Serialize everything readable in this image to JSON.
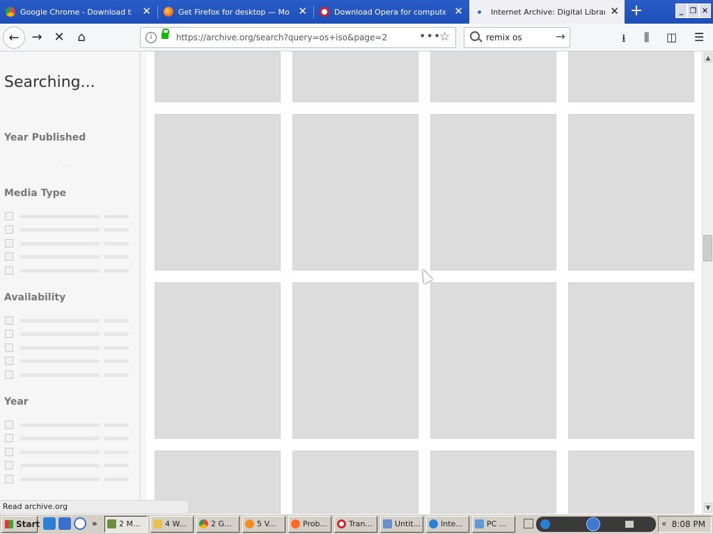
{
  "browser": {
    "tabs": [
      {
        "title": "Google Chrome - Download the Fa",
        "icon": "chrome-icon",
        "color": "#e8453c",
        "active": false
      },
      {
        "title": "Get Firefox for desktop — Mozilla",
        "icon": "firefox-icon",
        "color": "#ff8a1f",
        "active": false
      },
      {
        "title": "Download Opera for computers - (",
        "icon": "opera-icon",
        "color": "#d4232b",
        "active": false
      },
      {
        "title": "Internet Archive: Digital Library of",
        "icon": "archive-icon",
        "color": "#3b6bcf",
        "active": true
      }
    ],
    "window_buttons": {
      "minimize": "_",
      "restore": "❐",
      "close": "✕"
    },
    "new_tab": "+",
    "url": "https://archive.org/search?query=os+iso&page=2",
    "search_value": "remix os",
    "status_text": "Read archive.org"
  },
  "sidebar": {
    "heading": "Searching...",
    "facets": [
      {
        "title": "Year Published",
        "placeholder_count": 0
      },
      {
        "title": "Media Type",
        "placeholder_count": 5
      },
      {
        "title": "Availability",
        "placeholder_count": 5
      },
      {
        "title": "Year",
        "placeholder_count": 5
      }
    ]
  },
  "results": {
    "columns": 4,
    "visible_rows": 4,
    "tile_color": "#dcdcdc"
  },
  "taskbar": {
    "start_label": "Start",
    "buttons": [
      {
        "label": "2 M...",
        "icon": "mixed-windows-icon",
        "color": "#6b8f3a",
        "pressed": true
      },
      {
        "label": "4 W...",
        "icon": "folder-icon",
        "color": "#e8c24a",
        "pressed": false
      },
      {
        "label": "2 G...",
        "icon": "chrome-icon",
        "color": "#e8453c",
        "pressed": false
      },
      {
        "label": "5 V...",
        "icon": "firefox-icon",
        "color": "#ff8a1f",
        "pressed": false
      },
      {
        "label": "Prob...",
        "icon": "firefox-icon",
        "color": "#ff6a1f",
        "pressed": false
      },
      {
        "label": "Tran...",
        "icon": "opera-icon",
        "color": "#d4232b",
        "pressed": false
      },
      {
        "label": "Untit...",
        "icon": "document-icon",
        "color": "#6a8fcf",
        "pressed": false
      },
      {
        "label": "Inte...",
        "icon": "ie-icon",
        "color": "#2b7fd6",
        "pressed": false
      },
      {
        "label": "PC ...",
        "icon": "pc-icon",
        "color": "#5b9bd6",
        "pressed": false
      }
    ],
    "clock": "8:08 PM"
  }
}
